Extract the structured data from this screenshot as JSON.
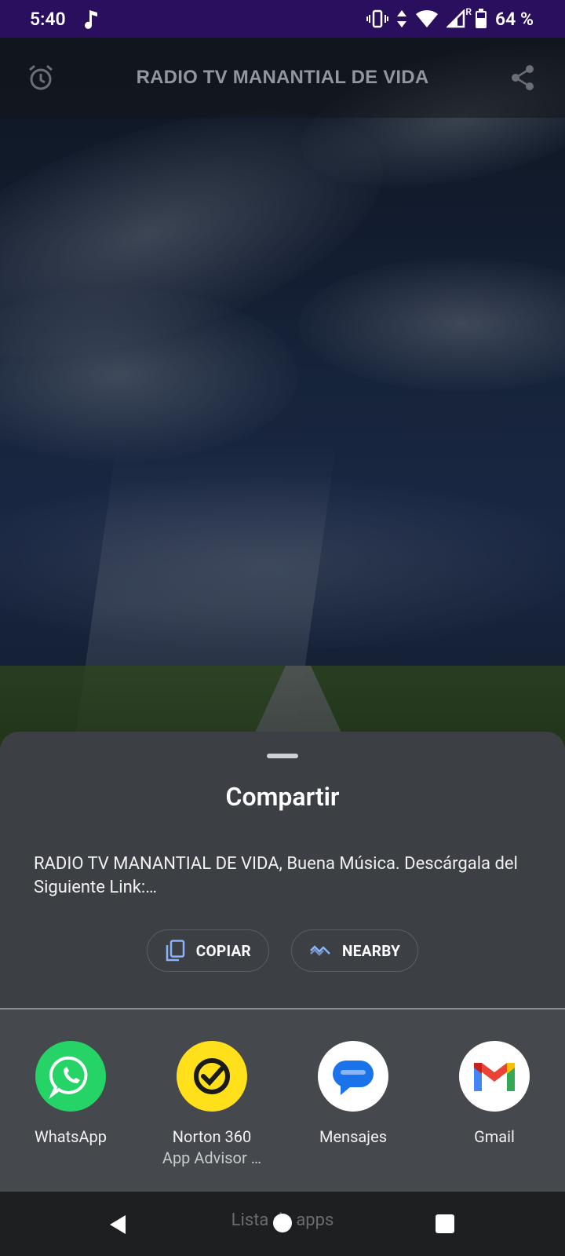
{
  "status_bar": {
    "time": "5:40",
    "battery": "64 %",
    "signal_label": "R",
    "icons": [
      "music-note-icon",
      "vibrate-icon",
      "data-arrows-icon",
      "wifi-icon",
      "signal-icon",
      "battery-icon"
    ]
  },
  "toolbar": {
    "title": "RADIO TV MANANTIAL DE VIDA",
    "left_icon": "alarm-clock-icon",
    "right_icon": "share-icon"
  },
  "share_sheet": {
    "title": "Compartir",
    "text": "RADIO TV MANANTIAL DE VIDA, Buena Música. Descárgala del Siguiente Link:…",
    "actions": [
      {
        "label": "COPIAR",
        "icon": "copy-icon"
      },
      {
        "label": "NEARBY",
        "icon": "nearby-icon"
      }
    ],
    "apps": [
      {
        "label": "WhatsApp",
        "sub": "",
        "icon": "whatsapp-icon",
        "color": "#25d366"
      },
      {
        "label": "Norton 360",
        "sub": "App Advisor …",
        "icon": "norton-icon",
        "color": "#ffe01b"
      },
      {
        "label": "Mensajes",
        "sub": "",
        "icon": "messages-icon",
        "color": "#ffffff"
      },
      {
        "label": "Gmail",
        "sub": "",
        "icon": "gmail-icon",
        "color": "#ffffff"
      }
    ]
  },
  "nav_bar": {
    "hint": "Lista de apps",
    "buttons": [
      "back-icon",
      "home-icon",
      "recents-icon"
    ]
  },
  "colors": {
    "status_bar_bg": "#2a0f5e",
    "sheet_bg": "#3c3f43",
    "apps_row_bg": "#45484c",
    "nav_bg": "#1e1f21",
    "chip_icon": "#8ab4f8"
  }
}
